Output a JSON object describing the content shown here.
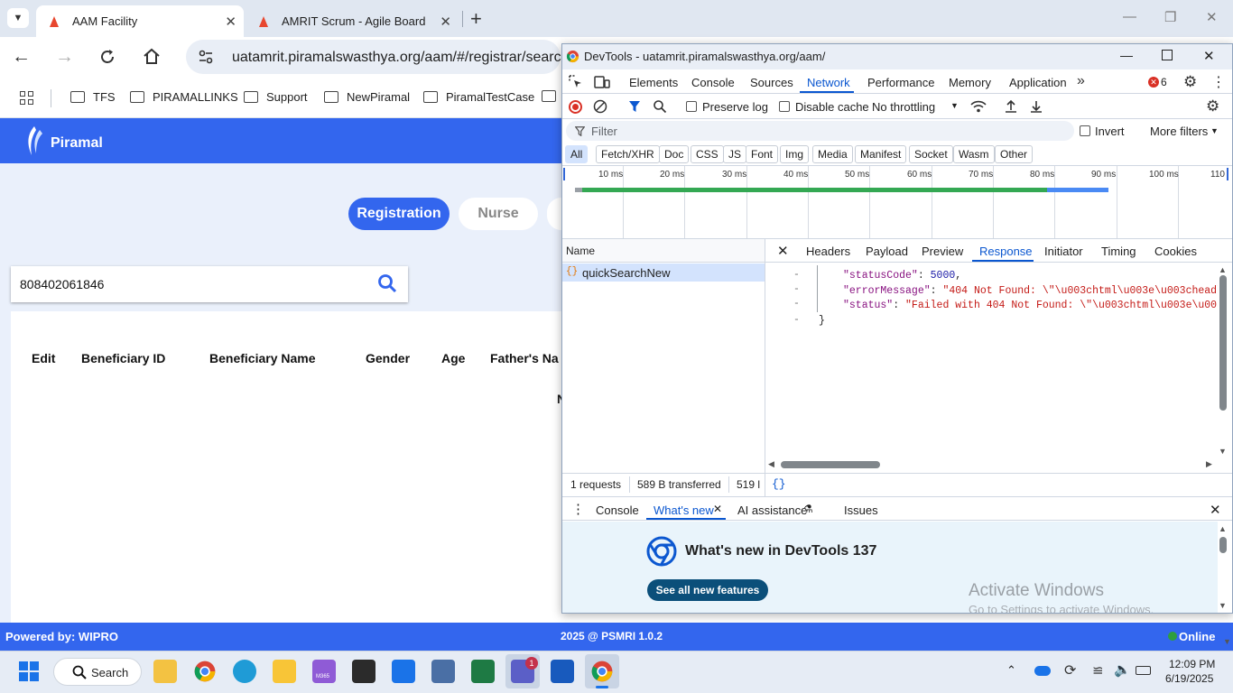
{
  "browser": {
    "tabs": [
      {
        "title": "AAM Facility",
        "active": true
      },
      {
        "title": "AMRIT Scrum - Agile Board",
        "active": false
      }
    ],
    "url": "uatamrit.piramalswasthya.org/aam/#/registrar/search",
    "bookmarks": [
      "TFS",
      "PIRAMALLINKS",
      "Support",
      "NewPiramal",
      "PiramalTestCase"
    ]
  },
  "app": {
    "logo_text": "Piramal",
    "role_tabs": [
      "Registration",
      "Nurse"
    ],
    "search_value": "808402061846",
    "table_headers": [
      "Edit",
      "Beneficiary ID",
      "Beneficiary Name",
      "Gender",
      "Age",
      "Father's Na"
    ],
    "row_partial": "N",
    "footer_left": "Powered by: WIPRO",
    "footer_center": "2025 @ PSMRI 1.0.2",
    "footer_status": "Online",
    "colors": {
      "brand": "#3366ee",
      "accent": "#3366ee",
      "online": "#2e9e3e"
    }
  },
  "devtools": {
    "title": "DevTools - uatamrit.piramalswasthya.org/aam/",
    "tabs": [
      "Elements",
      "Console",
      "Sources",
      "Network",
      "Performance",
      "Memory",
      "Application"
    ],
    "active_tab": "Network",
    "error_count": "6",
    "toolbar": {
      "preserve_log": "Preserve log",
      "disable_cache": "Disable cache",
      "throttling": "No throttling"
    },
    "filter_placeholder": "Filter",
    "invert_label": "Invert",
    "more_filters": "More filters",
    "type_filters": [
      "All",
      "Fetch/XHR",
      "Doc",
      "CSS",
      "JS",
      "Font",
      "Img",
      "Media",
      "Manifest",
      "Socket",
      "Wasm",
      "Other"
    ],
    "timeline_ticks": [
      "10 ms",
      "20 ms",
      "30 ms",
      "40 ms",
      "50 ms",
      "60 ms",
      "70 ms",
      "80 ms",
      "90 ms",
      "100 ms",
      "110"
    ],
    "name_header": "Name",
    "request_name": "quickSearchNew",
    "detail_tabs": [
      "Headers",
      "Payload",
      "Preview",
      "Response",
      "Initiator",
      "Timing",
      "Cookies"
    ],
    "active_detail_tab": "Response",
    "response_lines": [
      {
        "key": "\"statusCode\"",
        "sep": ": ",
        "value": "5000",
        "trail": ","
      },
      {
        "key": "\"errorMessage\"",
        "sep": ": ",
        "value": "\"404 Not Found: \\\"\\u003chtml\\u003e\\u003chead\\u0",
        "trail": ""
      },
      {
        "key": "\"status\"",
        "sep": ": ",
        "value": "\"Failed with 404 Not Found: \\\"\\u003chtml\\u003e\\u003ch",
        "trail": ""
      }
    ],
    "closing_brace": "}",
    "statusbar": {
      "requests": "1 requests",
      "transferred": "589 B transferred",
      "resources": "519 l"
    },
    "drawer_tabs": [
      "Console",
      "What's new",
      "AI assistance",
      "Issues"
    ],
    "active_drawer_tab": "What's new",
    "whats_new_title": "What's new in DevTools 137",
    "see_all_button": "See all new features",
    "watermark_line1": "Activate Windows",
    "watermark_line2": "Go to Settings to activate Windows."
  },
  "taskbar": {
    "search_label": "Search",
    "time": "12:09 PM",
    "date": "6/19/2025",
    "teams_badge": "1",
    "m365_label": "M365"
  }
}
